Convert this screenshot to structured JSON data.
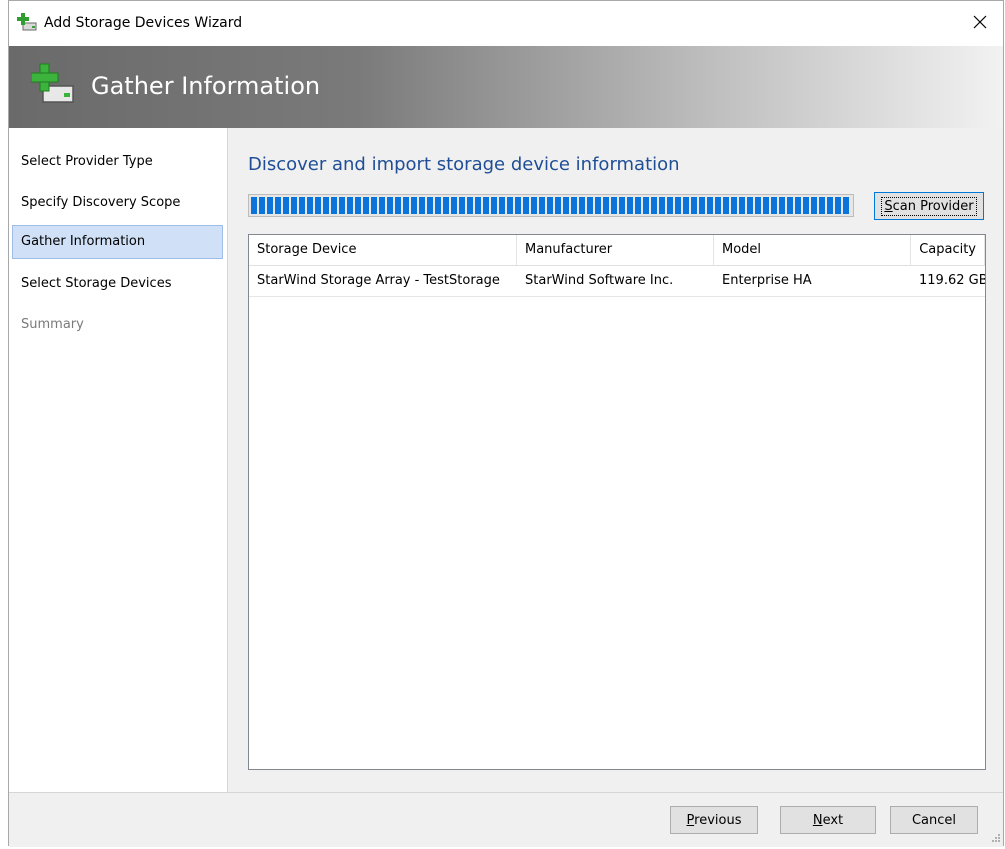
{
  "window": {
    "title": "Add Storage Devices Wizard",
    "close_icon": "close-icon"
  },
  "banner": {
    "title": "Gather Information",
    "icon": "add-storage-icon"
  },
  "sidebar": {
    "items": [
      {
        "label": "Select Provider Type",
        "state": "normal"
      },
      {
        "label": "Specify Discovery Scope",
        "state": "normal"
      },
      {
        "label": "Gather Information",
        "state": "selected"
      },
      {
        "label": "Select Storage Devices",
        "state": "normal"
      },
      {
        "label": "Summary",
        "state": "disabled"
      }
    ]
  },
  "main": {
    "heading": "Discover and import storage device information",
    "progress": 1.0,
    "scan_button": {
      "label_mnemonic": "S",
      "label_rest": "can Provider"
    },
    "table": {
      "columns": [
        "Storage Device",
        "Manufacturer",
        "Model",
        "Capacity"
      ],
      "rows": [
        [
          "StarWind Storage Array - TestStorage",
          "StarWind Software Inc.",
          "Enterprise HA",
          "119.62 GB"
        ]
      ]
    }
  },
  "footer": {
    "previous": {
      "label_mnemonic": "P",
      "label_rest": "revious"
    },
    "next": {
      "label_mnemonic": "N",
      "label_rest": "ext"
    },
    "cancel": "Cancel"
  },
  "colors": {
    "accent": "#0a74da",
    "heading": "#1f4e96",
    "selected_nav": "#cfe0f7"
  }
}
